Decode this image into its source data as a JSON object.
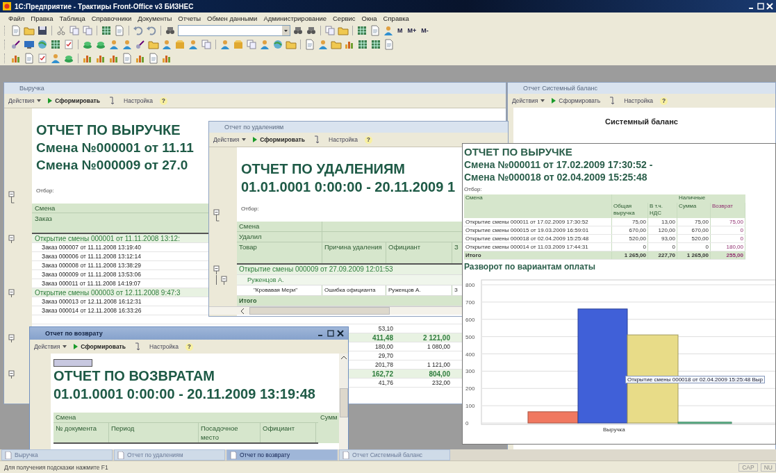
{
  "window": {
    "title": "1С:Предприятие - Трактиры Front-Office v3 БИЗНЕС"
  },
  "menu": [
    "Файл",
    "Правка",
    "Таблица",
    "Справочники",
    "Документы",
    "Отчеты",
    "Обмен данными",
    "Администрирование",
    "Сервис",
    "Окна",
    "Справка"
  ],
  "toolbar_text_buttons": [
    "M",
    "M+",
    "M-"
  ],
  "revenue_window": {
    "title": "Выручка",
    "active": false,
    "toolbar": {
      "actions": "Действия",
      "generate": "Сформировать",
      "settings": "Настройка",
      "help": "?"
    },
    "report": {
      "title": "ОТЧЕТ ПО ВЫРУЧКЕ",
      "subtitles": [
        "Смена №000001 от 11.11",
        "Смена №000009 от 27.0"
      ],
      "filter_label": "Отбор:",
      "header": [
        "Смена",
        "Заказ"
      ],
      "rows": [
        {
          "kind": "group",
          "label": "Открытие смены 000001 от 11.11.2008 13:12:"
        },
        {
          "kind": "order",
          "label": "Заказ 000007 от 11.11.2008 13:19:40"
        },
        {
          "kind": "order",
          "label": "Заказ 000006 от 11.11.2008 13:12:14"
        },
        {
          "kind": "order",
          "label": "Заказ 000008 от 11.11.2008 13:38:29"
        },
        {
          "kind": "order",
          "label": "Заказ 000009 от 11.11.2008 13:53:06"
        },
        {
          "kind": "order",
          "label": "Заказ 000011 от 11.11.2008 14:19:07"
        },
        {
          "kind": "group",
          "label": "Открытие смены 000003 от 12.11.2008 9:47:3"
        },
        {
          "kind": "order",
          "label": "Заказ 000013 от 12.11.2008 16:12:31"
        },
        {
          "kind": "order",
          "label": "Заказ 000014 от 12.11.2008 16:33:26"
        },
        {
          "kind": "order"
        },
        {
          "kind": "order",
          "column_3": "53,10"
        },
        {
          "kind": "group",
          "column_3": "411,48",
          "column_4": "2 121,00"
        },
        {
          "kind": "order",
          "column_3": "180,00",
          "column_4": "1 080,00"
        },
        {
          "kind": "order",
          "column_3": "29,70"
        },
        {
          "kind": "order",
          "column_3": "201,78",
          "column_4": "1 121,00"
        },
        {
          "kind": "group",
          "column_3": "162,72",
          "column_4": "804,00"
        },
        {
          "kind": "order",
          "column_3": "41,76",
          "column_4": "232,00"
        }
      ]
    }
  },
  "balance_window": {
    "title": "Отчет  Системный баланс",
    "active": false,
    "toolbar": {
      "actions": "Действия",
      "generate": "Сформировать",
      "settings": "Настройка",
      "help": "?"
    },
    "report_title": "Системный баланс"
  },
  "deletions_window": {
    "title": "Отчет по удалениям",
    "active": false,
    "toolbar": {
      "actions": "Действия",
      "generate": "Сформировать",
      "settings": "Настройка",
      "help": "?"
    },
    "report": {
      "title": "ОТЧЕТ ПО УДАЛЕНИЯМ",
      "period": "01.01.0001 0:00:00 - 20.11.2009 1",
      "filter_label": "Отбор:",
      "header": [
        [
          "Смена"
        ],
        [
          "Удалил"
        ],
        [
          "Товар",
          "Причина удаления",
          "Официант",
          "З"
        ]
      ],
      "rows": [
        {
          "kind": "group",
          "cells": [
            "Открытие смены 000009 от 27.09.2009 12:01:53"
          ]
        },
        {
          "kind": "waiter",
          "cells": [
            "Руженцов А."
          ]
        },
        {
          "kind": "item",
          "cells": [
            "\"Кровавая Мери\"",
            "Ошибка официанта",
            "Руженцов А.",
            "З"
          ]
        },
        {
          "kind": "total",
          "cells": [
            "Итого"
          ]
        }
      ]
    }
  },
  "overlay_report": {
    "title": "ОТЧЕТ ПО ВЫРУЧКЕ",
    "subtitles": [
      "Смена №000011 от 17.02.2009 17:30:52 -",
      "Смена №000018 от 02.04.2009 15:25:48"
    ],
    "filter_label": "Отбор:",
    "table": {
      "columns": [
        "Смена",
        "Общая выручка",
        "В т.ч. НДС",
        "Сумма",
        "Возврат"
      ],
      "column_group": "Наличные",
      "rows": [
        {
          "kind": "row",
          "cells": [
            "Открытие смены 000011 от 17.02.2009 17:30:52",
            "75,00",
            "13,00",
            "75,00",
            "75,00"
          ]
        },
        {
          "kind": "row",
          "cells": [
            "Открытие смены 000015 от 19.03.2009 16:59:01",
            "670,00",
            "120,00",
            "670,00",
            "0"
          ]
        },
        {
          "kind": "row",
          "cells": [
            "Открытие смены 000018 от 02.04.2009 15:25:48",
            "520,00",
            "93,00",
            "520,00",
            "0"
          ]
        },
        {
          "kind": "row",
          "cells": [
            "Открытие смены 000014 от 11.03.2009 17:44:31",
            "0",
            "0",
            "0",
            "180,00"
          ]
        },
        {
          "kind": "total",
          "cells": [
            "Итого",
            "1 265,00",
            "227,70",
            "1 265,00",
            "255,00"
          ]
        }
      ]
    },
    "chart_title": "Разворот по вариантам оплаты",
    "chart_data": {
      "type": "bar",
      "categories": [
        "Выручка"
      ],
      "series": [
        {
          "color": "#f07860",
          "values": [
            65
          ]
        },
        {
          "color": "#4060d8",
          "values": [
            660
          ]
        },
        {
          "color": "#e8dc88",
          "values": [
            510
          ]
        },
        {
          "color": "#60c090",
          "values": [
            5
          ]
        }
      ],
      "ylim": [
        0,
        800
      ],
      "grid": true,
      "yticks": [
        0,
        100,
        200,
        300,
        400,
        500,
        600,
        700,
        800
      ]
    },
    "chart_tooltip": "Открытие смены 000018 от 02.04.2009 15:25:48 Выр"
  },
  "returns_window": {
    "title": "Отчет по возврату",
    "active": true,
    "toolbar": {
      "actions": "Действия",
      "generate": "Сформировать",
      "settings": "Настройка",
      "help": "?"
    },
    "report": {
      "title": "ОТЧЕТ ПО ВОЗВРАТАМ",
      "period": "01.01.0001 0:00:00 - 20.11.2009 13:19:48",
      "header_top": [
        "Смена",
        "Сумм"
      ],
      "header": [
        "№ документа",
        "Период",
        "Посадочное место",
        "Официант"
      ]
    }
  },
  "taskbar": [
    {
      "label": "Выручка",
      "selected": false
    },
    {
      "label": "Отчет по удалениям",
      "selected": false
    },
    {
      "label": "Отчет по возврату",
      "selected": true
    },
    {
      "label": "Отчет  Системный баланс",
      "selected": false
    }
  ],
  "status_bar": {
    "hint": "Для получения подсказки нажмите F1",
    "indicators": [
      "CAP",
      "NU"
    ]
  }
}
